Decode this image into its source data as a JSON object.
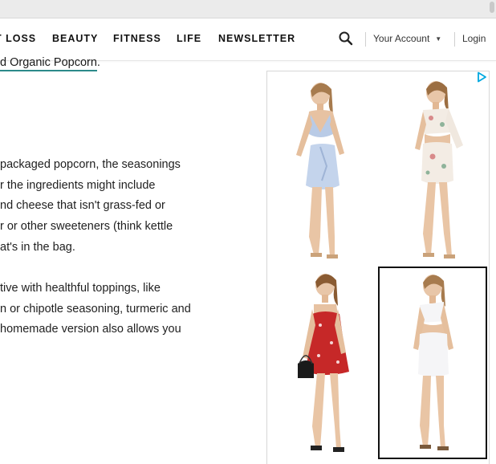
{
  "nav": {
    "items": [
      {
        "label": "T LOSS"
      },
      {
        "label": "BEAUTY"
      },
      {
        "label": "FITNESS"
      },
      {
        "label": "LIFE"
      },
      {
        "label": "NEWSLETTER"
      }
    ],
    "search_icon": "search-icon",
    "account_label": "Your Account",
    "login_label": "Login"
  },
  "article": {
    "top_link": "d Organic Popcorn",
    "top_link_suffix": ".",
    "para1": [
      "packaged popcorn, the seasonings",
      "r the ingredients might include",
      "nd cheese that isn't grass-fed or",
      "r or other sweeteners (think kettle",
      "at's in the bag."
    ],
    "para2": [
      "tive with healthful toppings, like",
      "n or chipotle seasoning, turmeric and",
      " homemade version also allows you"
    ]
  },
  "ad": {
    "adchoices_icon": "adchoices-icon",
    "products": [
      {
        "name": "light blue wrap skirt set"
      },
      {
        "name": "floral one-shoulder set"
      },
      {
        "name": "red floral dress"
      },
      {
        "name": "white one-shoulder set"
      }
    ]
  },
  "colors": {
    "link_underline": "#2c8a8a",
    "adchoices": "#00a8e0",
    "dress_red": "#c62828"
  }
}
